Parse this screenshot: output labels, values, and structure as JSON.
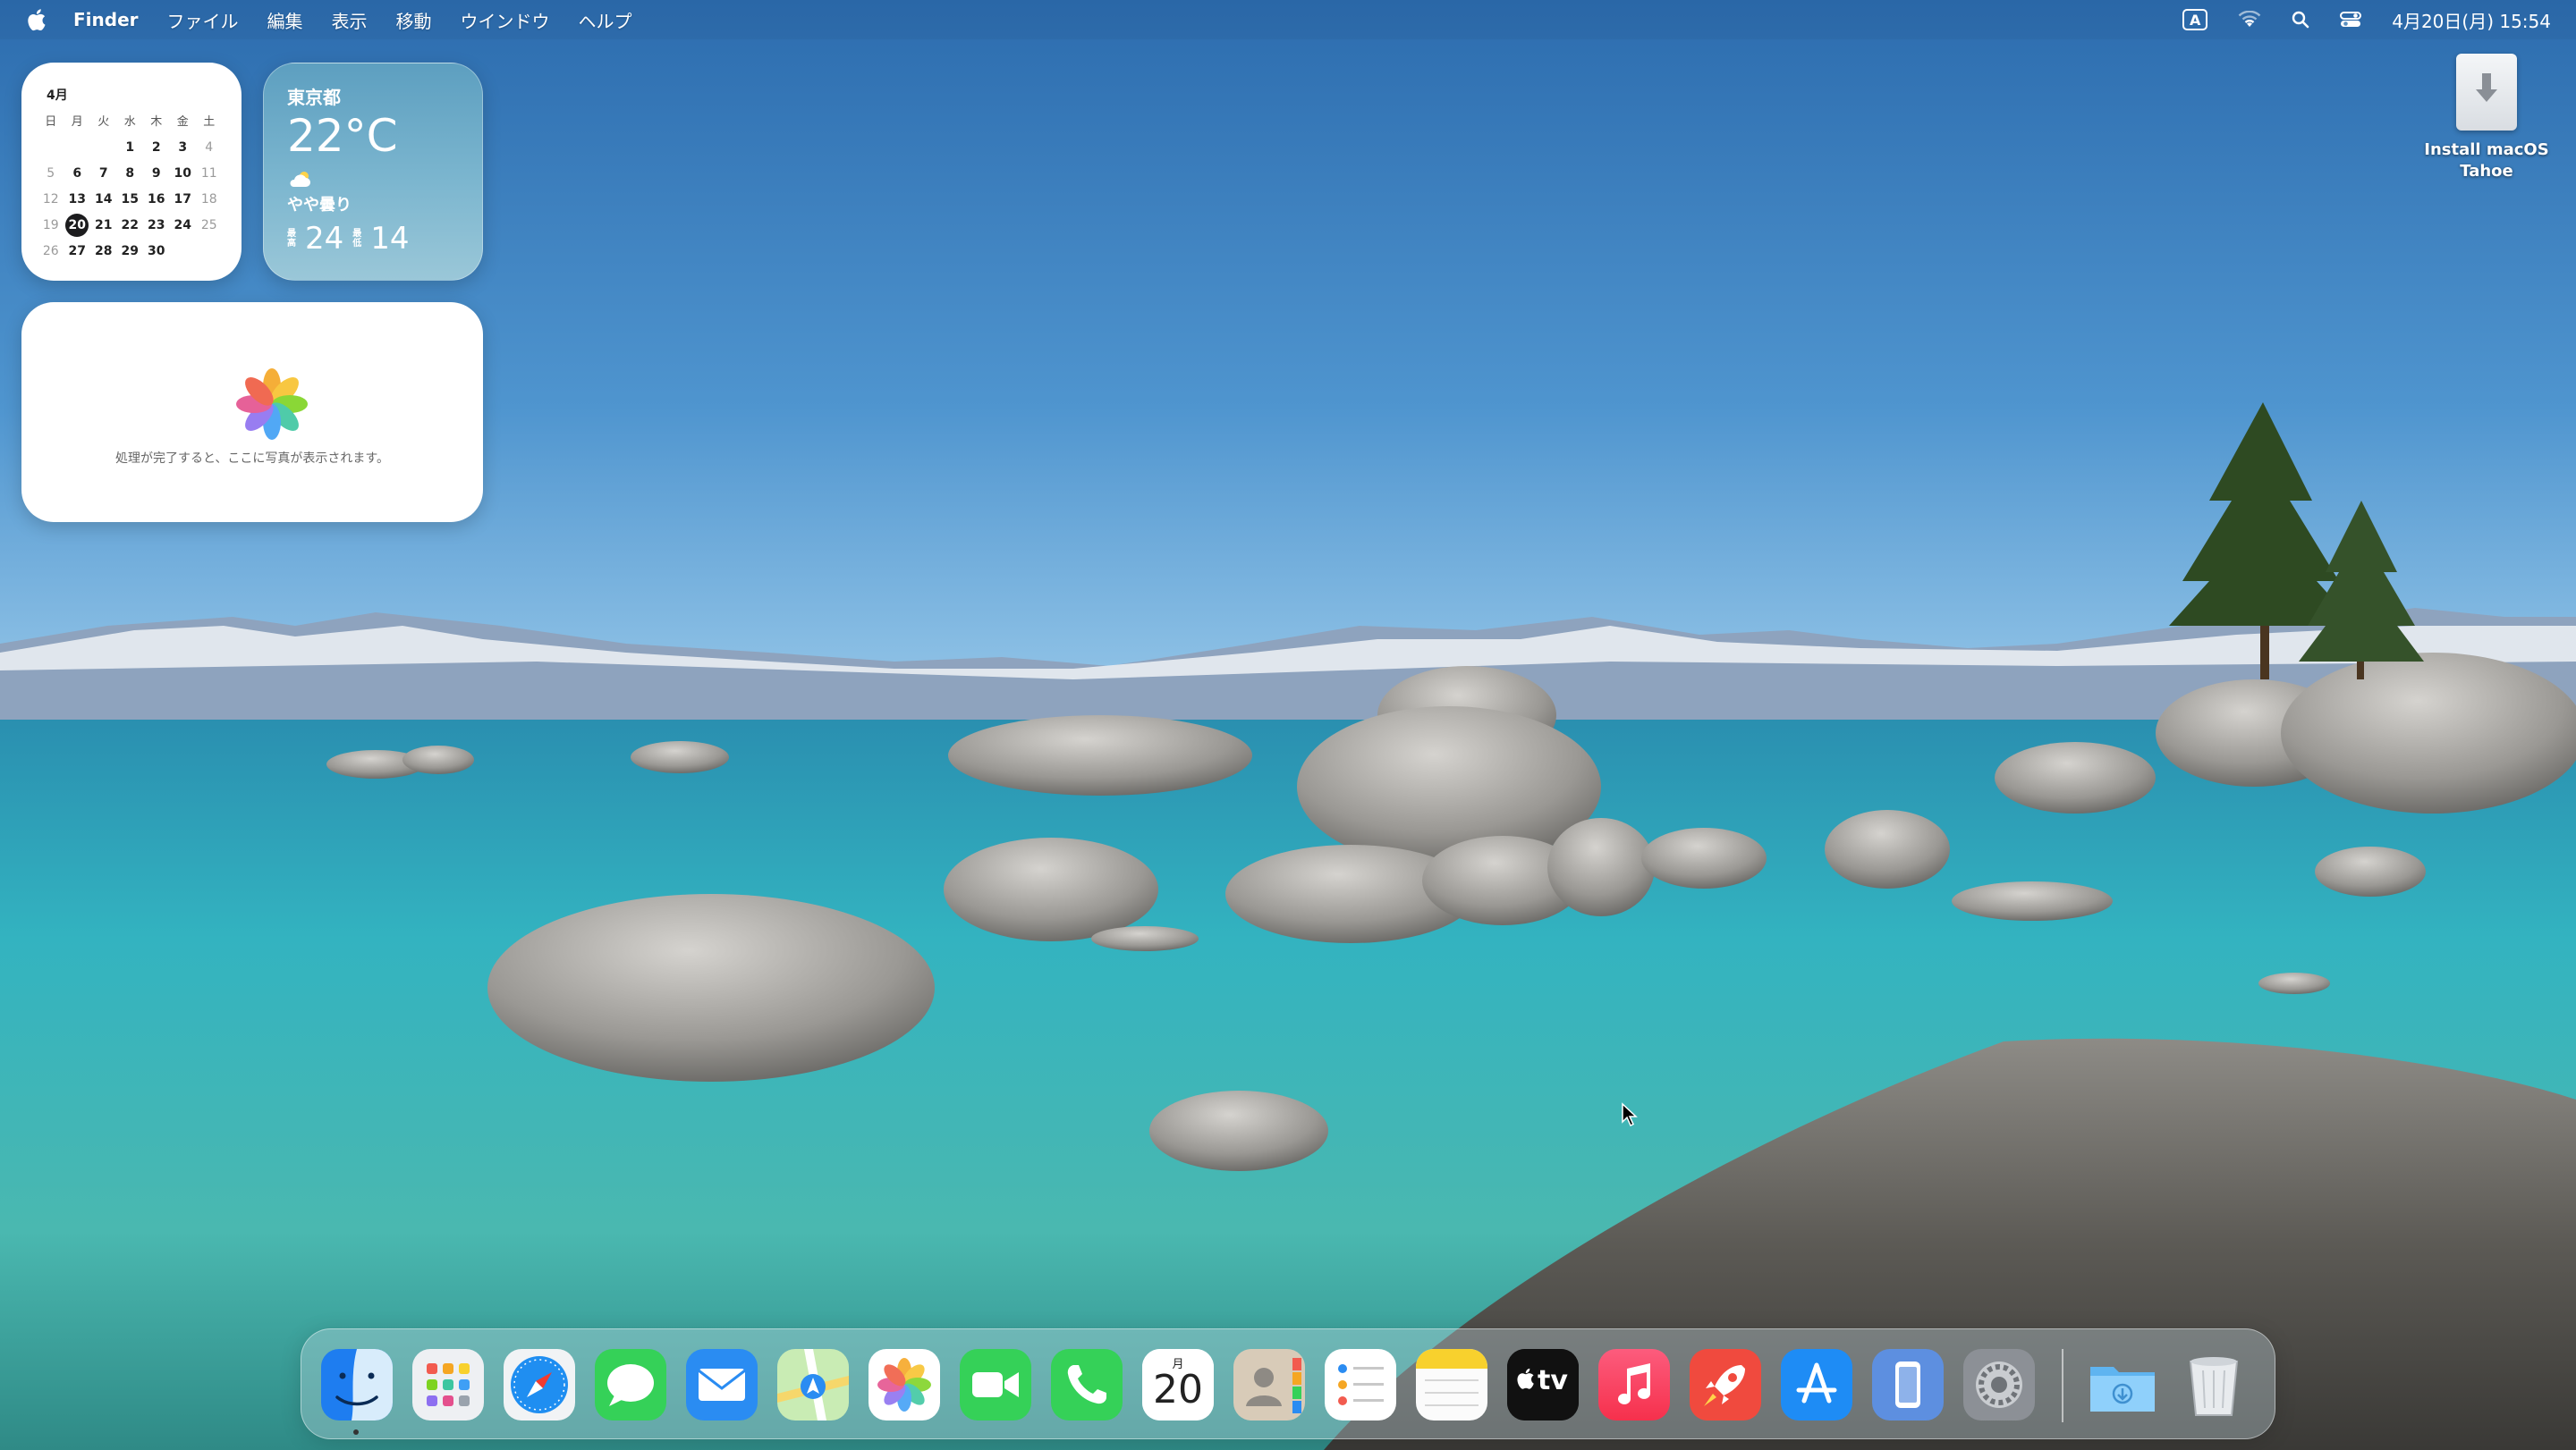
{
  "menubar": {
    "app_name": "Finder",
    "menus": [
      "ファイル",
      "編集",
      "表示",
      "移動",
      "ウインドウ",
      "ヘルプ"
    ],
    "input_mode": "A",
    "datetime": "4月20日(月) 15:54",
    "icons": [
      "apple-icon",
      "input-mode-icon",
      "wifi-icon",
      "search-icon",
      "control-center-icon"
    ]
  },
  "calendar_widget": {
    "month": "4月",
    "weekdays": [
      "日",
      "月",
      "火",
      "水",
      "木",
      "金",
      "土"
    ],
    "days": [
      "",
      "",
      "",
      "1",
      "2",
      "3",
      "4",
      "5",
      "6",
      "7",
      "8",
      "9",
      "10",
      "11",
      "12",
      "13",
      "14",
      "15",
      "16",
      "17",
      "18",
      "19",
      "20",
      "21",
      "22",
      "23",
      "24",
      "25",
      "26",
      "27",
      "28",
      "29",
      "30"
    ],
    "today": "20"
  },
  "weather_widget": {
    "city": "東京都",
    "temperature": "22°C",
    "condition": "やや曇り",
    "high_label": "最高",
    "high": "24",
    "low_label": "最低",
    "low": "14",
    "icon": "partly-cloudy-icon"
  },
  "photos_widget": {
    "message": "処理が完了すると、ここに写真が表示されます。",
    "icon": "photos-icon"
  },
  "desktop_icon": {
    "label_line1": "Install macOS",
    "label_line2": "Tahoe",
    "icon": "installer-icon"
  },
  "dock": {
    "apps": [
      {
        "name": "Finder",
        "icon": "finder-icon"
      },
      {
        "name": "Launchpad",
        "icon": "launchpad-icon"
      },
      {
        "name": "Safari",
        "icon": "safari-icon"
      },
      {
        "name": "Messages",
        "icon": "messages-icon"
      },
      {
        "name": "Mail",
        "icon": "mail-icon"
      },
      {
        "name": "Maps",
        "icon": "maps-icon"
      },
      {
        "name": "Photos",
        "icon": "photos-icon"
      },
      {
        "name": "FaceTime",
        "icon": "facetime-icon"
      },
      {
        "name": "Phone",
        "icon": "phone-icon"
      },
      {
        "name": "Calendar",
        "icon": "calendar-icon",
        "month": "月",
        "day": "20"
      },
      {
        "name": "Contacts",
        "icon": "contacts-icon"
      },
      {
        "name": "Reminders",
        "icon": "reminders-icon"
      },
      {
        "name": "Notes",
        "icon": "notes-icon"
      },
      {
        "name": "Apple TV",
        "icon": "apple-tv-icon",
        "label": "tv"
      },
      {
        "name": "Music",
        "icon": "music-icon"
      },
      {
        "name": "Rocket Typist",
        "icon": "rocket-icon"
      },
      {
        "name": "App Store",
        "icon": "app-store-icon"
      },
      {
        "name": "iPhone Mirroring",
        "icon": "iphone-mirroring-icon"
      },
      {
        "name": "System Settings",
        "icon": "settings-icon"
      },
      {
        "name": "Downloads",
        "icon": "downloads-folder-icon"
      },
      {
        "name": "Trash",
        "icon": "trash-icon"
      }
    ]
  },
  "colors": {
    "menu_text": "#ffffff",
    "today_circle": "#1c1c1e",
    "weather_bg": "#6aa8c6"
  }
}
